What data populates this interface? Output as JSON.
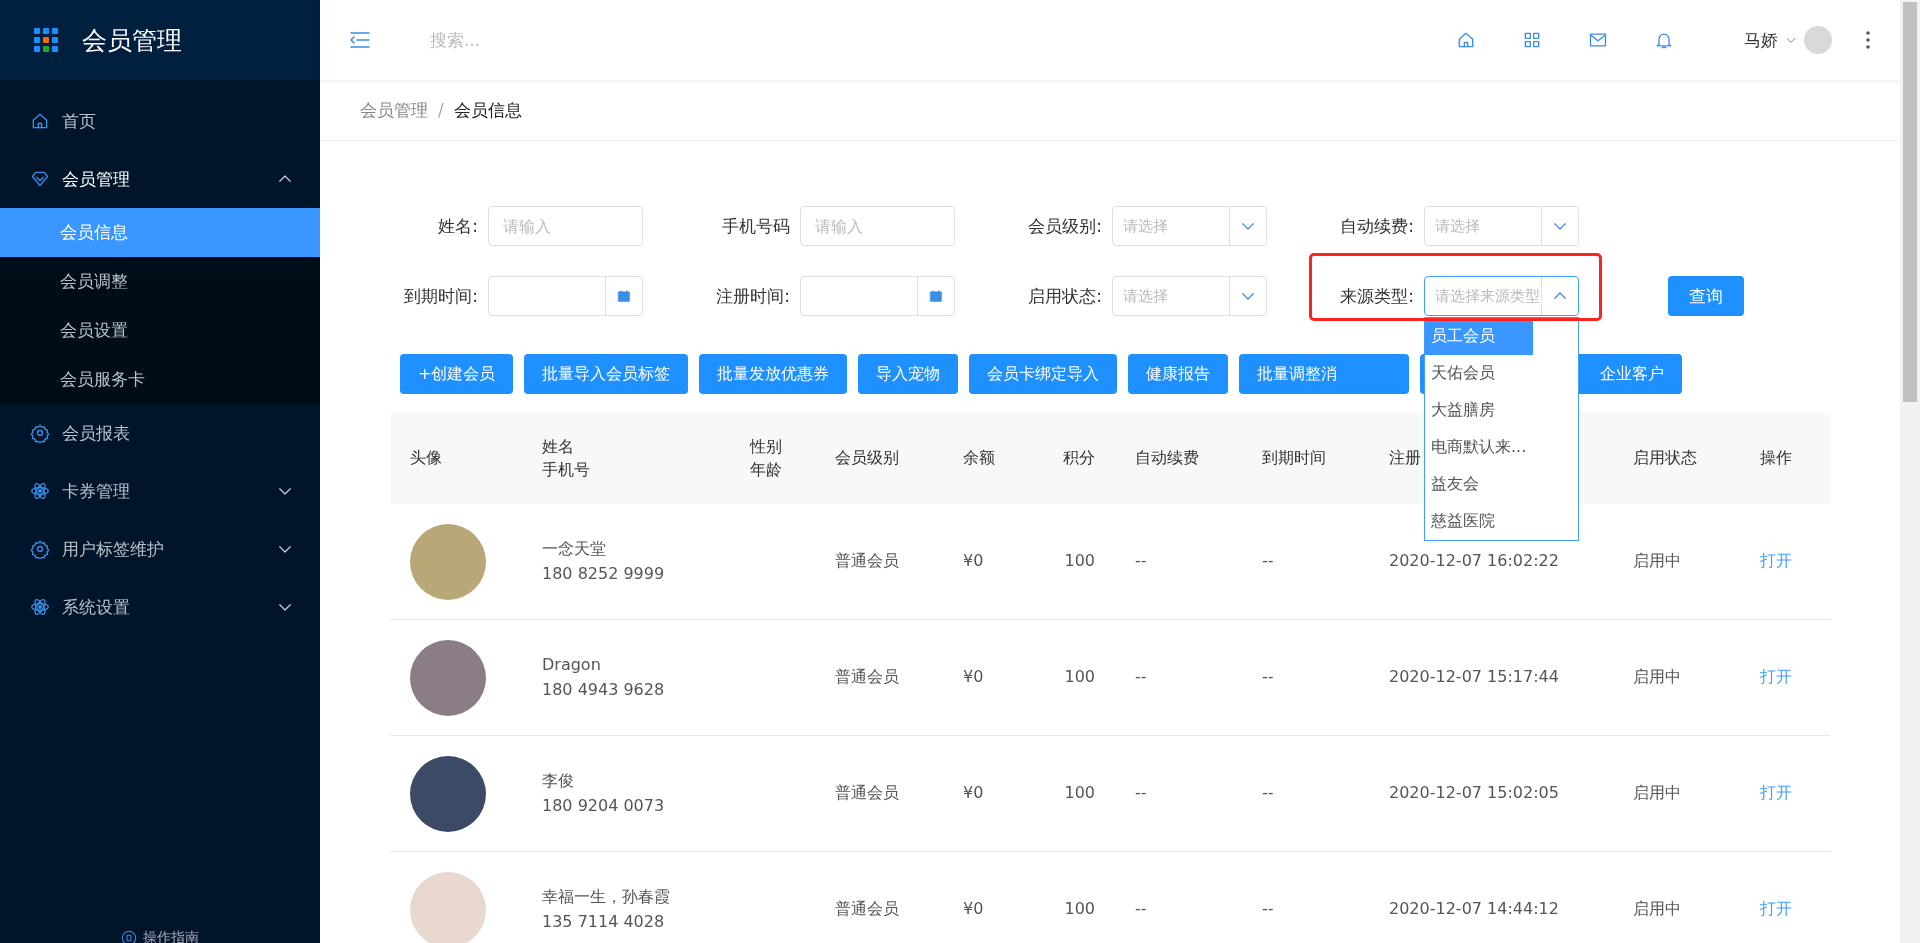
{
  "sidebar": {
    "logo_text": "会员管理",
    "items": [
      {
        "label": "首页",
        "kind": "link"
      },
      {
        "label": "会员管理",
        "kind": "group",
        "expanded": true,
        "children": [
          {
            "label": "会员信息",
            "selected": true
          },
          {
            "label": "会员调整",
            "selected": false
          },
          {
            "label": "会员设置",
            "selected": false
          },
          {
            "label": "会员服务卡",
            "selected": false
          }
        ]
      },
      {
        "label": "会员报表",
        "kind": "link"
      },
      {
        "label": "卡券管理",
        "kind": "group",
        "expanded": false
      },
      {
        "label": "用户标签维护",
        "kind": "group",
        "expanded": false
      },
      {
        "label": "系统设置",
        "kind": "group",
        "expanded": false
      }
    ],
    "footer_link": "操作指南"
  },
  "header": {
    "search": {
      "placeholder": "搜索..."
    },
    "user_name": "马娇"
  },
  "breadcrumb": [
    "会员管理",
    "会员信息"
  ],
  "breadcrumb_separator": "/",
  "filters": [
    [
      {
        "label": "姓名:",
        "kind": "text",
        "placeholder": "请输入"
      },
      {
        "label": "手机号码",
        "kind": "text",
        "placeholder": "请输入"
      },
      {
        "label": "会员级别:",
        "kind": "select",
        "placeholder": "请选择",
        "open": false
      },
      {
        "label": "自动续费:",
        "kind": "select",
        "placeholder": "请选择",
        "open": false
      }
    ],
    [
      {
        "label": "到期时间:",
        "kind": "date"
      },
      {
        "label": "注册时间:",
        "kind": "date"
      },
      {
        "label": "启用状态:",
        "kind": "select",
        "placeholder": "请选择",
        "open": false
      },
      {
        "label": "来源类型:",
        "kind": "select",
        "placeholder": "请选择来源类型",
        "open": true,
        "options": [
          {
            "label": "员工会员",
            "selected": true
          },
          {
            "label": "天佑会员",
            "selected": false
          },
          {
            "label": "大益膳房",
            "selected": false
          },
          {
            "label": "电商默认来...",
            "selected": false
          },
          {
            "label": "益友会",
            "selected": false
          },
          {
            "label": "慈益医院",
            "selected": false
          }
        ]
      }
    ]
  ],
  "query_button": "查询",
  "actions": [
    "+创建会员",
    "批量导入会员标签",
    "批量发放优惠券",
    "导入宠物",
    "会员卡绑定导入",
    "健康报告",
    "批量调整消",
    "企业客户"
  ],
  "table": {
    "columns": [
      [
        "头像"
      ],
      [
        "姓名",
        "手机号"
      ],
      [
        "性别",
        "年龄"
      ],
      [
        "会员级别"
      ],
      [
        "余额"
      ],
      [
        "积分"
      ],
      [
        "自动续费"
      ],
      [
        "到期时间"
      ],
      [
        "注册"
      ],
      [
        "启用状态"
      ],
      [
        "操作"
      ]
    ],
    "rows": [
      {
        "name": "一念天堂",
        "phone": "180 8252 9999",
        "level": "普通会员",
        "balance": "¥0",
        "points": "100",
        "auto_renew": "--",
        "expire": "--",
        "registered": "2020-12-07 16:02:22",
        "status": "启用中",
        "action": "打开"
      },
      {
        "name": "Dragon",
        "phone": "180 4943 9628",
        "level": "普通会员",
        "balance": "¥0",
        "points": "100",
        "auto_renew": "--",
        "expire": "--",
        "registered": "2020-12-07 15:17:44",
        "status": "启用中",
        "action": "打开"
      },
      {
        "name": "李俊",
        "phone": "180 9204 0073",
        "level": "普通会员",
        "balance": "¥0",
        "points": "100",
        "auto_renew": "--",
        "expire": "--",
        "registered": "2020-12-07 15:02:05",
        "status": "启用中",
        "action": "打开"
      },
      {
        "name": "幸福一生，孙春霞",
        "phone": "135 7114 4028",
        "level": "普通会员",
        "balance": "¥0",
        "points": "100",
        "auto_renew": "--",
        "expire": "--",
        "registered": "2020-12-07 14:44:12",
        "status": "启用中",
        "action": "打开"
      }
    ]
  }
}
